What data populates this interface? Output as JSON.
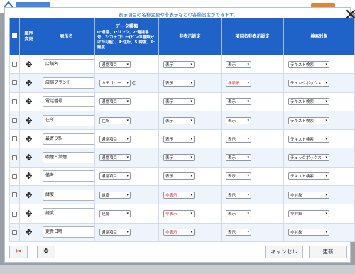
{
  "dialog": {
    "caption": "表示項目の名称変更や非表示などの各種設定ができます。",
    "close_label": "✕"
  },
  "columns": {
    "order": "順序\n変更",
    "name": "表示名",
    "datatype_title": "データ種類",
    "datatype_desc": "0:通常、1:リンク、2:電話番号、3:カテゴリー(ピンの種類分けが可能)、4:住所、5:緯度、6:経度",
    "visibility": "非表示設定",
    "label_visibility": "項目名非表示設定",
    "search": "検索対象"
  },
  "rows": [
    {
      "name": "店舗名",
      "type": "通常項目",
      "vis": "表示",
      "vis_hidden": false,
      "label": "表示",
      "label_hidden": false,
      "search": "テキスト検索",
      "help": false
    },
    {
      "name": "店舗ブランド",
      "type": "カテゴリー",
      "vis": "表示",
      "vis_hidden": false,
      "label": "非表示",
      "label_hidden": true,
      "search": "チェックボックス",
      "help": true
    },
    {
      "name": "電話番号",
      "type": "通常項目",
      "vis": "表示",
      "vis_hidden": false,
      "label": "表示",
      "label_hidden": false,
      "search": "テキスト検索",
      "help": false
    },
    {
      "name": "住所",
      "type": "住所",
      "vis": "表示",
      "vis_hidden": false,
      "label": "表示",
      "label_hidden": false,
      "search": "テキスト検索",
      "help": false
    },
    {
      "name": "最寄り駅",
      "type": "通常項目",
      "vis": "表示",
      "vis_hidden": false,
      "label": "表示",
      "label_hidden": false,
      "search": "テキスト検索",
      "help": false
    },
    {
      "name": "喫煙・禁煙",
      "type": "通常項目",
      "vis": "表示",
      "vis_hidden": false,
      "label": "表示",
      "label_hidden": false,
      "search": "チェックボックス",
      "help": false
    },
    {
      "name": "備考",
      "type": "通常項目",
      "vis": "表示",
      "vis_hidden": false,
      "label": "表示",
      "label_hidden": false,
      "search": "テキスト検索",
      "help": false
    },
    {
      "name": "緯度",
      "type": "緯度",
      "vis": "非表示",
      "vis_hidden": true,
      "label": "表示",
      "label_hidden": false,
      "search": "非対象",
      "help": false
    },
    {
      "name": "経度",
      "type": "経度",
      "vis": "非表示",
      "vis_hidden": true,
      "label": "表示",
      "label_hidden": false,
      "search": "非対象",
      "help": false
    },
    {
      "name": "更新日時",
      "type": "通常項目",
      "vis": "非表示",
      "vis_hidden": true,
      "label": "表示",
      "label_hidden": false,
      "search": "非対象",
      "help": false
    }
  ],
  "footer": {
    "cancel": "キャンセル",
    "update": "更新"
  },
  "icons": {
    "drag": "drag-move-icon",
    "delete": "scissors-icon",
    "add": "add-row-icon"
  },
  "colors": {
    "header": "#1f62c8",
    "accent": "#1f5fbf",
    "hidden": "#d22020"
  }
}
